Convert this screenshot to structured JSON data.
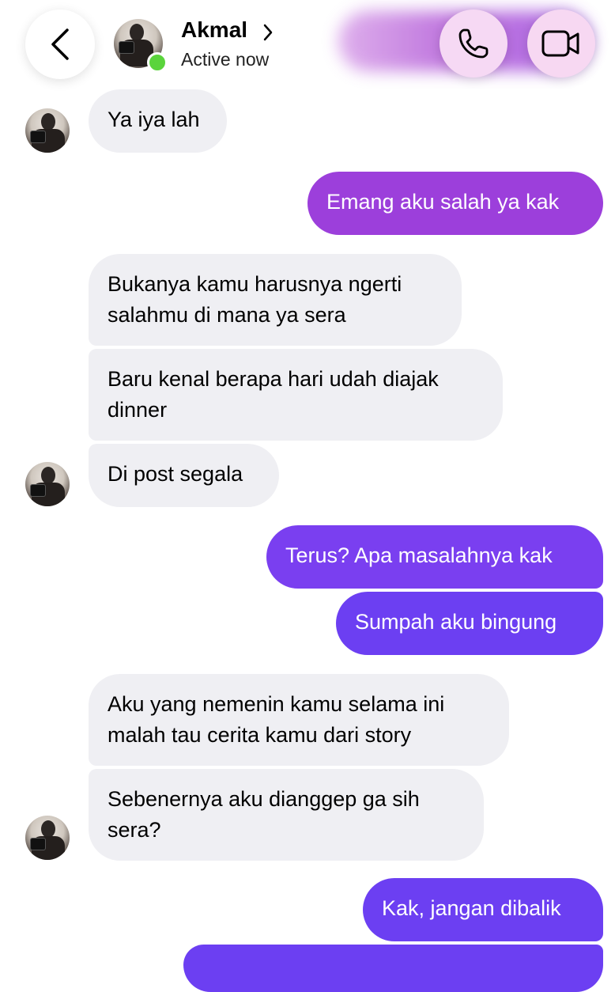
{
  "header": {
    "contact_name": "Akmal",
    "status": "Active now",
    "back_icon": "chevron-left-icon",
    "call_icon": "phone-icon",
    "video_icon": "video-camera-icon"
  },
  "colors": {
    "incoming_bubble": "#efeff3",
    "outgoing_gradient_top": "#a13fd9",
    "outgoing_gradient_bottom": "#6c3ff2",
    "online": "#5ad43c"
  },
  "messages": [
    {
      "direction": "in",
      "text": "Ya iya lah"
    },
    {
      "direction": "out",
      "text": "Emang aku salah ya kak"
    },
    {
      "direction": "in",
      "text": "Bukanya kamu harusnya ngerti salahmu di mana ya sera"
    },
    {
      "direction": "in",
      "text": "Baru kenal berapa hari udah diajak dinner"
    },
    {
      "direction": "in",
      "text": "Di post segala"
    },
    {
      "direction": "out",
      "text": "Terus? Apa masalahnya kak"
    },
    {
      "direction": "out",
      "text": "Sumpah aku bingung"
    },
    {
      "direction": "in",
      "text": "Aku yang nemenin kamu selama ini malah tau cerita kamu dari story"
    },
    {
      "direction": "in",
      "text": "Sebenernya aku dianggep ga sih sera?"
    },
    {
      "direction": "out",
      "text": "Kak, jangan dibalik"
    }
  ]
}
